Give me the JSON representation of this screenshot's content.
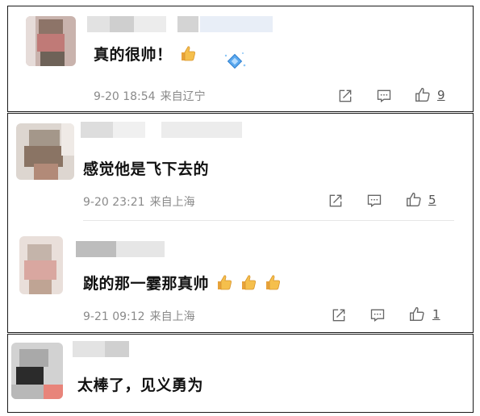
{
  "comments": [
    {
      "text": "真的很帅！",
      "date": "9-20 18:54",
      "location": "来自辽宁",
      "likes": "9",
      "emoji_count": 1
    },
    {
      "text": "感觉他是飞下去的",
      "date": "9-20 23:21",
      "location": "来自上海",
      "likes": "5",
      "emoji_count": 0
    },
    {
      "text": "跳的那一霎那真帅",
      "date": "9-21 09:12",
      "location": "来自上海",
      "likes": "1",
      "emoji_count": 3
    },
    {
      "text": "太棒了，见义勇为",
      "emoji_count": 0
    }
  ],
  "icons": {
    "share": "share-icon",
    "comment": "comment-icon",
    "like": "thumbs-up-icon",
    "emoji": "thumbs-up-emoji",
    "badge": "diamond-badge-icon"
  },
  "colors": {
    "text": "#111111",
    "meta": "#8a8a8a",
    "icon": "#666666",
    "emoji": "#f2b33d",
    "badge": "#5aa8ee"
  }
}
